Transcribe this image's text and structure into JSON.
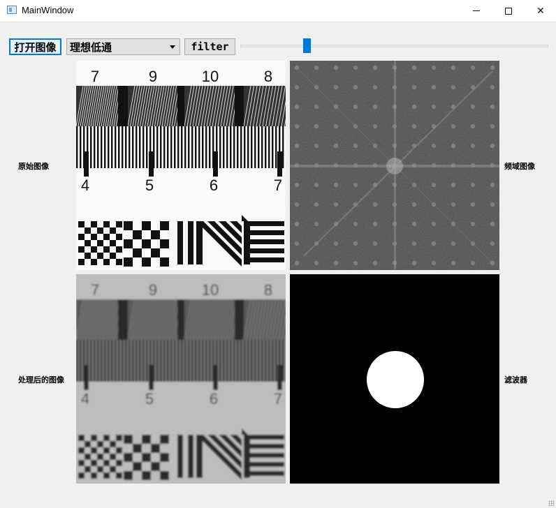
{
  "window": {
    "title": "MainWindow",
    "controls": {
      "minimize": "—",
      "maximize": "☐",
      "close": "✕"
    }
  },
  "toolbar": {
    "open_label": "打开图像",
    "filter_type_selected": "理想低通",
    "filter_label": "filter",
    "slider_value_fraction": 0.21
  },
  "labels": {
    "original": "原始图像",
    "frequency": "频域图像",
    "processed": "处理后的图像",
    "filter": "滤波器"
  },
  "test_chart": {
    "top_numbers": [
      "7",
      "9",
      "10",
      "8"
    ],
    "bottom_numbers": [
      "4",
      "5",
      "6",
      "7"
    ]
  },
  "colors": {
    "accent": "#0078d7",
    "panel_dark": "#000000",
    "mask_white": "#ffffff"
  }
}
